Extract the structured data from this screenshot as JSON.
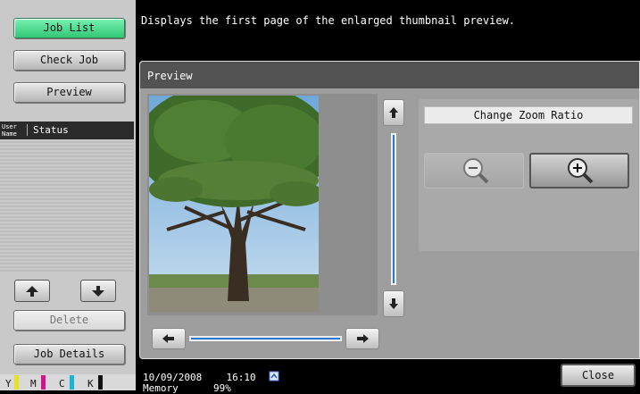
{
  "left_panel": {
    "job_list_label": "Job List",
    "check_job_label": "Check Job",
    "preview_label": "Preview",
    "col_user_name": "User Name",
    "col_user_line1": "User",
    "col_user_line2": "Name",
    "col_status": "Status",
    "delete_label": "Delete",
    "job_details_label": "Job Details",
    "toner": [
      {
        "label": "Y",
        "color": "#e8e020"
      },
      {
        "label": "M",
        "color": "#d4148c"
      },
      {
        "label": "C",
        "color": "#18b4d8"
      },
      {
        "label": "K",
        "color": "#111111"
      }
    ]
  },
  "message": "Displays the first page of the enlarged thumbnail preview.",
  "preview_window": {
    "title": "Preview",
    "zoom": {
      "label": "Change Zoom Ratio",
      "zoom_out_icon": "zoom-out-magnifier-icon",
      "zoom_in_icon": "zoom-in-magnifier-icon"
    }
  },
  "status_bar": {
    "date": "10/09/2008",
    "time": "16:10",
    "memory_label": "Memory",
    "memory_value": "99%",
    "close_label": "Close"
  },
  "colors": {
    "active_button": "#49d98a",
    "scroll_accent": "#2a78d6",
    "background": "#000000"
  }
}
